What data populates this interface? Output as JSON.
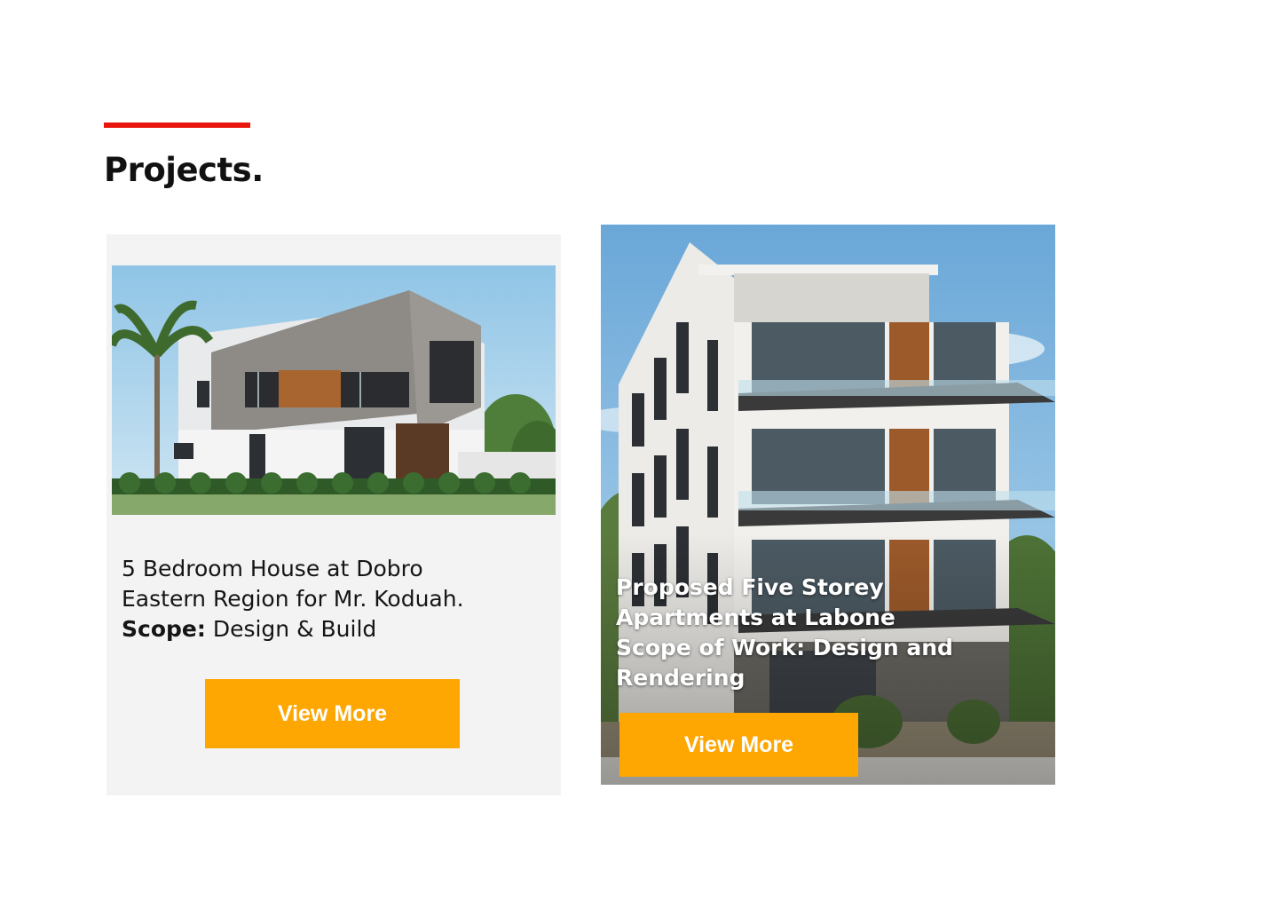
{
  "section": {
    "title": "Projects."
  },
  "projects": [
    {
      "title_line1": "5 Bedroom House at Dobro",
      "title_line2": "Eastern Region for Mr. Koduah.",
      "scope_label": "Scope:",
      "scope_value": "Design & Build",
      "button_label": "View More"
    },
    {
      "title": "Proposed Five Storey Apartments at Labone",
      "scope": "Scope of Work: Design and Rendering",
      "button_label": "View More"
    }
  ],
  "colors": {
    "accent": "#e8160c",
    "button": "#fea602",
    "card_bg": "#f3f3f3"
  }
}
